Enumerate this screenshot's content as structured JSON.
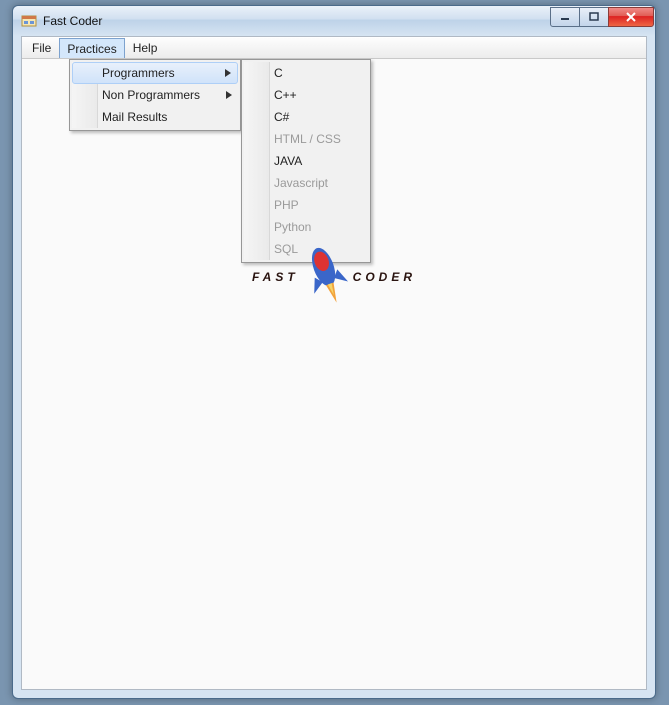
{
  "window": {
    "title": "Fast Coder"
  },
  "menubar": {
    "file": "File",
    "practices": "Practices",
    "help": "Help"
  },
  "dropdown": {
    "programmers": "Programmers",
    "non_programmers": "Non Programmers",
    "mail_results": "Mail Results"
  },
  "submenu": {
    "items": [
      {
        "label": "C",
        "enabled": true
      },
      {
        "label": "C++",
        "enabled": true
      },
      {
        "label": "C#",
        "enabled": true
      },
      {
        "label": "HTML / CSS",
        "enabled": false
      },
      {
        "label": "JAVA",
        "enabled": true
      },
      {
        "label": "Javascript",
        "enabled": false
      },
      {
        "label": "PHP",
        "enabled": false
      },
      {
        "label": "Python",
        "enabled": false
      },
      {
        "label": "SQL",
        "enabled": false
      }
    ]
  },
  "logo": {
    "left": "FAST",
    "right": "CODER"
  }
}
